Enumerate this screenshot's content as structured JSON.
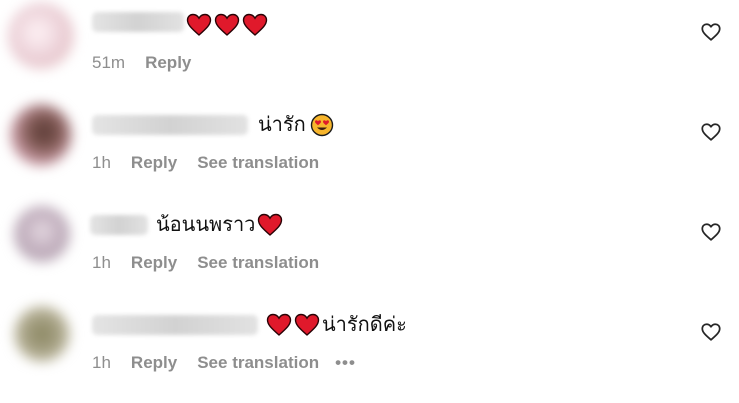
{
  "comments": [
    {
      "time": "51m",
      "reply_label": "Reply",
      "hearts": 3,
      "text": "",
      "emoji": "",
      "has_translation": false,
      "has_more": false
    },
    {
      "time": "1h",
      "reply_label": "Reply",
      "translation_label": "See translation",
      "hearts": 0,
      "text": "น่ารัก",
      "emoji": "heart-eyes-emoji",
      "has_translation": true,
      "has_more": false
    },
    {
      "time": "1h",
      "reply_label": "Reply",
      "translation_label": "See translation",
      "hearts_after_text": 1,
      "text": "น้อนนพราว",
      "has_translation": true,
      "has_more": false
    },
    {
      "time": "1h",
      "reply_label": "Reply",
      "translation_label": "See translation",
      "hearts": 2,
      "text": "น่ารักดีค่ะ",
      "has_translation": true,
      "has_more": true,
      "more_label": "•••"
    }
  ],
  "colors": {
    "meta_text": "#8e8e8e",
    "heart_red": "#e0192b",
    "background": "#ffffff"
  },
  "icons": {
    "like": "heart-outline-icon",
    "reaction": "red-heart-emoji"
  }
}
